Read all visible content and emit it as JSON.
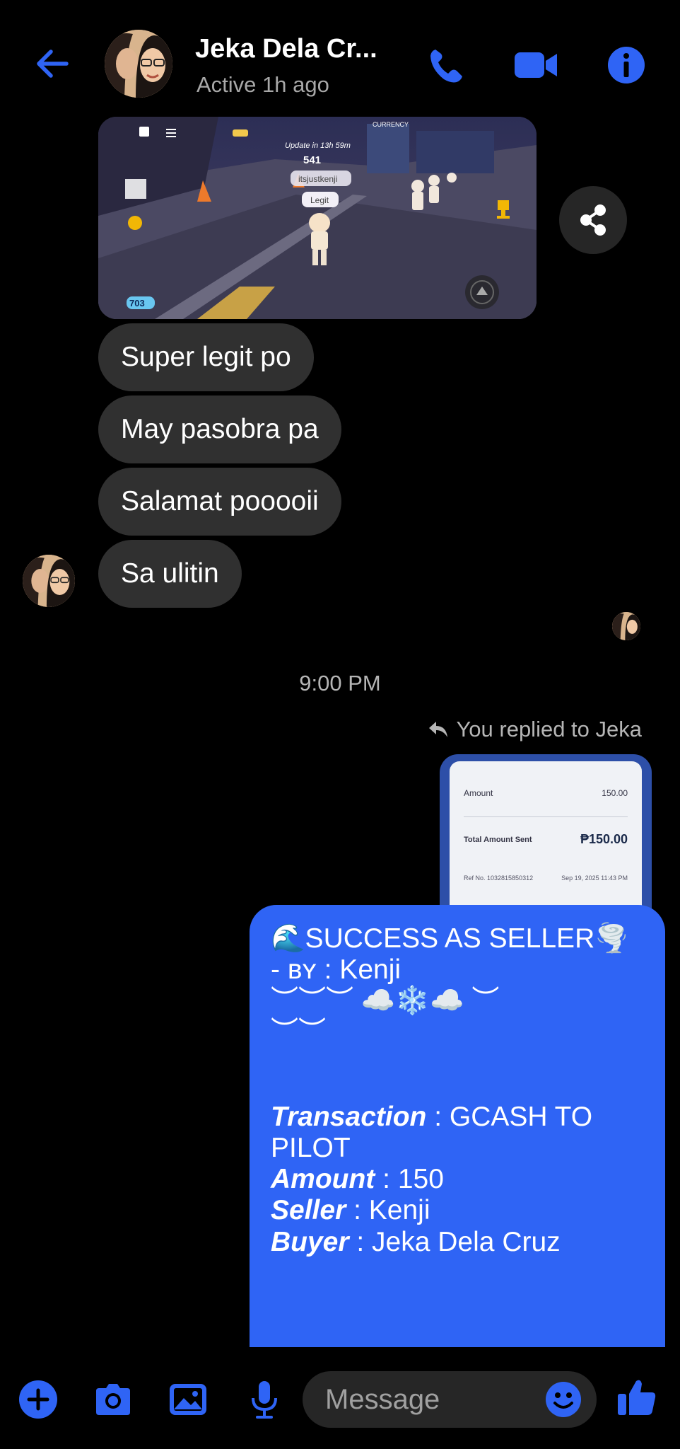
{
  "header": {
    "title": "Jeka Dela Cr...",
    "status": "Active 1h ago",
    "accent_color": "#2f64f5",
    "icons": [
      "back-arrow-icon",
      "phone-icon",
      "video-camera-icon",
      "info-icon"
    ]
  },
  "game_image": {
    "overlay_update": "Update in 13h 59m",
    "overlay_count": "541",
    "name_tag": "itsjustkenji",
    "chat_tag": "Legit",
    "gem_count": "703",
    "hud_label": "CURRENCY"
  },
  "messages_in": [
    {
      "text": "Super legit po"
    },
    {
      "text": "May pasobra pa"
    },
    {
      "text": "Salamat pooooii"
    },
    {
      "text": "Sa ulitin"
    }
  ],
  "timestamp": "9:00 PM",
  "reply_note": "You replied to Jeka",
  "receipt": {
    "amount_label": "Amount",
    "amount_value": "150.00",
    "total_label": "Total Amount Sent",
    "total_value": "₱150.00",
    "ref_label": "Ref No. 1032815850312",
    "ref_date": "Sep 19, 2025 11:43 PM"
  },
  "outgoing": {
    "line1": "🌊SUCCESS AS SELLER🌪️",
    "line2": "- ʙʏ : Kenji",
    "line3": "︶︶︶ ☁️❄️☁️ ︶",
    "line4": "︶︶",
    "transaction_label": "Transaction",
    "transaction_value": " : GCASH TO PILOT",
    "amount_label": "Amount",
    "amount_value": " : 150",
    "seller_label": "Seller",
    "seller_value": " : Kenji",
    "buyer_label": "Buyer",
    "buyer_value": " : Jeka Dela Cruz"
  },
  "composer": {
    "placeholder": "Message",
    "icons": [
      "plus-icon",
      "camera-icon",
      "gallery-icon",
      "microphone-icon",
      "emoji-icon",
      "thumbs-up-icon"
    ]
  }
}
